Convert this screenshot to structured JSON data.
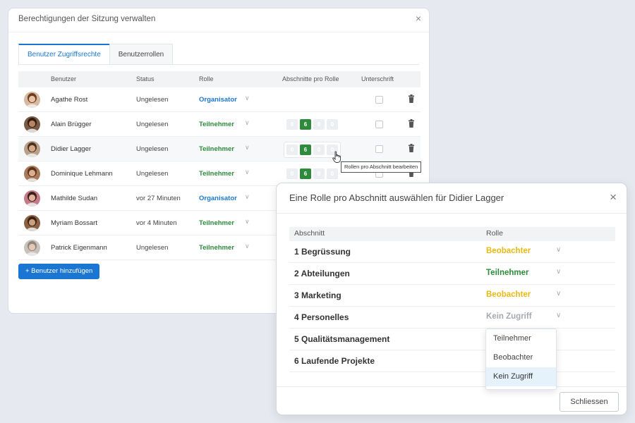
{
  "back_panel": {
    "title": "Berechtigungen der Sitzung verwalten",
    "close_glyph": "×",
    "tabs": [
      {
        "label": "Benutzer Zugriffsrechte",
        "active": true
      },
      {
        "label": "Benutzerrollen",
        "active": false
      }
    ],
    "columns": {
      "user": "Benutzer",
      "status": "Status",
      "role": "Rolle",
      "sections": "Abschnitte pro Rolle",
      "signature": "Unterschrift"
    },
    "rows": [
      {
        "name": "Agathe Rost",
        "status": "Ungelesen",
        "role": "Organisator",
        "role_type": "org",
        "sections": []
      },
      {
        "name": "Alain Brügger",
        "status": "Ungelesen",
        "role": "Teilnehmer",
        "role_type": "tn",
        "sections": [
          "0",
          "6",
          "0",
          "0"
        ]
      },
      {
        "name": "Didier Lagger",
        "status": "Ungelesen",
        "role": "Teilnehmer",
        "role_type": "tn",
        "sections": [
          "0",
          "6",
          "0",
          "0"
        ]
      },
      {
        "name": "Dominique Lehmann",
        "status": "Ungelesen",
        "role": "Teilnehmer",
        "role_type": "tn",
        "sections": [
          "0",
          "6",
          "0",
          "0"
        ]
      },
      {
        "name": "Mathilde Sudan",
        "status": "vor 27 Minuten",
        "role": "Organisator",
        "role_type": "org",
        "sections": []
      },
      {
        "name": "Myriam Bossart",
        "status": "vor 4 Minuten",
        "role": "Teilnehmer",
        "role_type": "tn",
        "sections": []
      },
      {
        "name": "Patrick Eigenmann",
        "status": "Ungelesen",
        "role": "Teilnehmer",
        "role_type": "tn",
        "sections": []
      }
    ],
    "add_button": "+  Benutzer hinzufügen",
    "tooltip": "Rollen pro Abschnitt bearbeiten"
  },
  "modal": {
    "title": "Eine Rolle pro Abschnitt auswählen für Didier Lagger",
    "close_glyph": "×",
    "col_section": "Abschnitt",
    "col_role": "Rolle",
    "sections": [
      {
        "name": "1 Begrüssung",
        "role": "Beobachter",
        "role_type": "beo"
      },
      {
        "name": "2 Abteilungen",
        "role": "Teilnehmer",
        "role_type": "tn"
      },
      {
        "name": "3 Marketing",
        "role": "Beobachter",
        "role_type": "beo"
      },
      {
        "name": "4 Personelles",
        "role": "Kein Zugriff",
        "role_type": "kz"
      },
      {
        "name": "5 Qualitätsmanagement",
        "role": "",
        "role_type": ""
      },
      {
        "name": "6 Laufende Projekte",
        "role": "",
        "role_type": ""
      }
    ],
    "dropdown_options": [
      "Teilnehmer",
      "Beobachter",
      "Kein Zugriff"
    ],
    "dropdown_selected": "Kein Zugriff",
    "close_button": "Schliessen"
  },
  "colors": {
    "primary_blue": "#1a76d2",
    "participant_green": "#2e8b3c",
    "observer_yellow": "#e8b90f",
    "no_access_gray": "#a4a9af"
  }
}
